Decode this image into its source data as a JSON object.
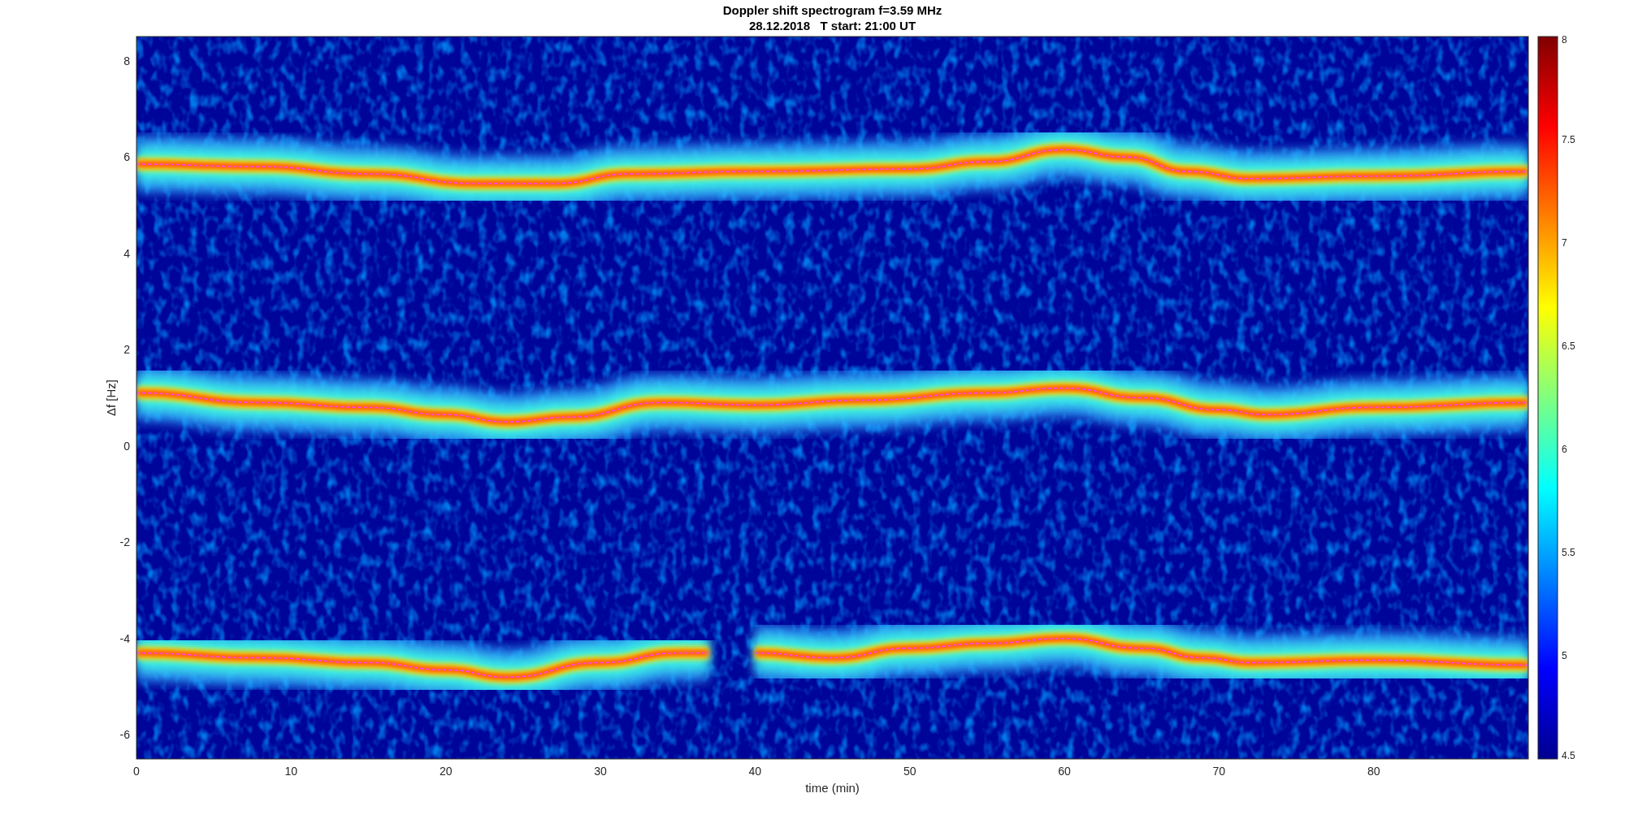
{
  "title": [
    "Doppler shift spectrogram f=3.59 MHz",
    "28.12.2018   T start: 21:00 UT"
  ],
  "ylabel": "Δf [Hz]",
  "xlabel": "time (min)",
  "yticks": [
    "8",
    "6",
    "4",
    "2",
    "0",
    "-2",
    "-4",
    "-6"
  ],
  "xticks": [
    "0",
    "10",
    "20",
    "30",
    "40",
    "50",
    "60",
    "70",
    "80"
  ],
  "colorbar_ticks": [
    "8",
    "7.5",
    "7",
    "6.5",
    "6",
    "5.5",
    "5",
    "4.5"
  ]
}
